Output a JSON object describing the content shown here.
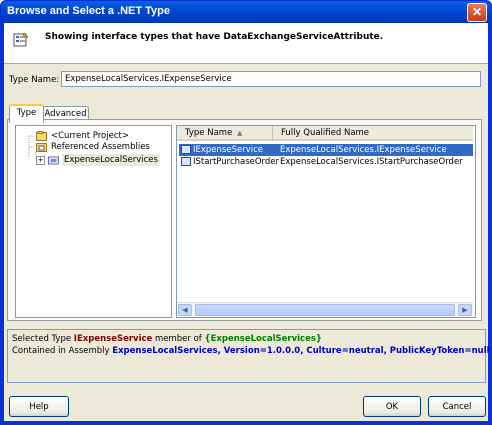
{
  "window": {
    "title": "Browse and Select a .NET Type",
    "close_symbol": "✕"
  },
  "header": {
    "text": "Showing interface types that have DataExchangeServiceAttribute.",
    "icon": "browse-type-icon"
  },
  "type_name": {
    "label": "Type Name:",
    "value": "ExpenseLocalServices.IExpenseService"
  },
  "tabs": [
    {
      "label": "Type"
    },
    {
      "label": "Advanced"
    }
  ],
  "tree": {
    "items": [
      {
        "label": "<Current Project>",
        "icon": "project-icon"
      },
      {
        "label": "Referenced Assemblies",
        "icon": "references-icon"
      },
      {
        "label": "ExpenseLocalServices",
        "icon": "assembly-icon",
        "expander": "+"
      }
    ]
  },
  "grid": {
    "columns": [
      "Type Name",
      "Fully Qualified Name"
    ],
    "sort_symbol": "▲",
    "rows": [
      {
        "name": "IExpenseService",
        "qualified": "ExpenseLocalServices.IExpenseService",
        "selected": true
      },
      {
        "name": "IStartPurchaseOrder",
        "qualified": "ExpenseLocalServices.IStartPurchaseOrder",
        "selected": false
      }
    ],
    "scroll_left": "◀",
    "scroll_right": "▶"
  },
  "info": {
    "line1_prefix": "Selected Type ",
    "line1_type": "IExpenseService",
    "line1_middle": " member of ",
    "line1_namespace": "{ExpenseLocalServices}",
    "line2_prefix": "Contained in Assembly ",
    "line2_assembly": "ExpenseLocalServices, Version=1.0.0.0, Culture=neutral, PublicKeyToken=null"
  },
  "buttons": {
    "help": "Help",
    "ok": "OK",
    "cancel": "Cancel"
  },
  "colors": {
    "titlebar": "#0046d5",
    "selection": "#316ac5",
    "type_color": "#800000",
    "namespace_color": "#008000",
    "assembly_color": "#0000c0"
  }
}
